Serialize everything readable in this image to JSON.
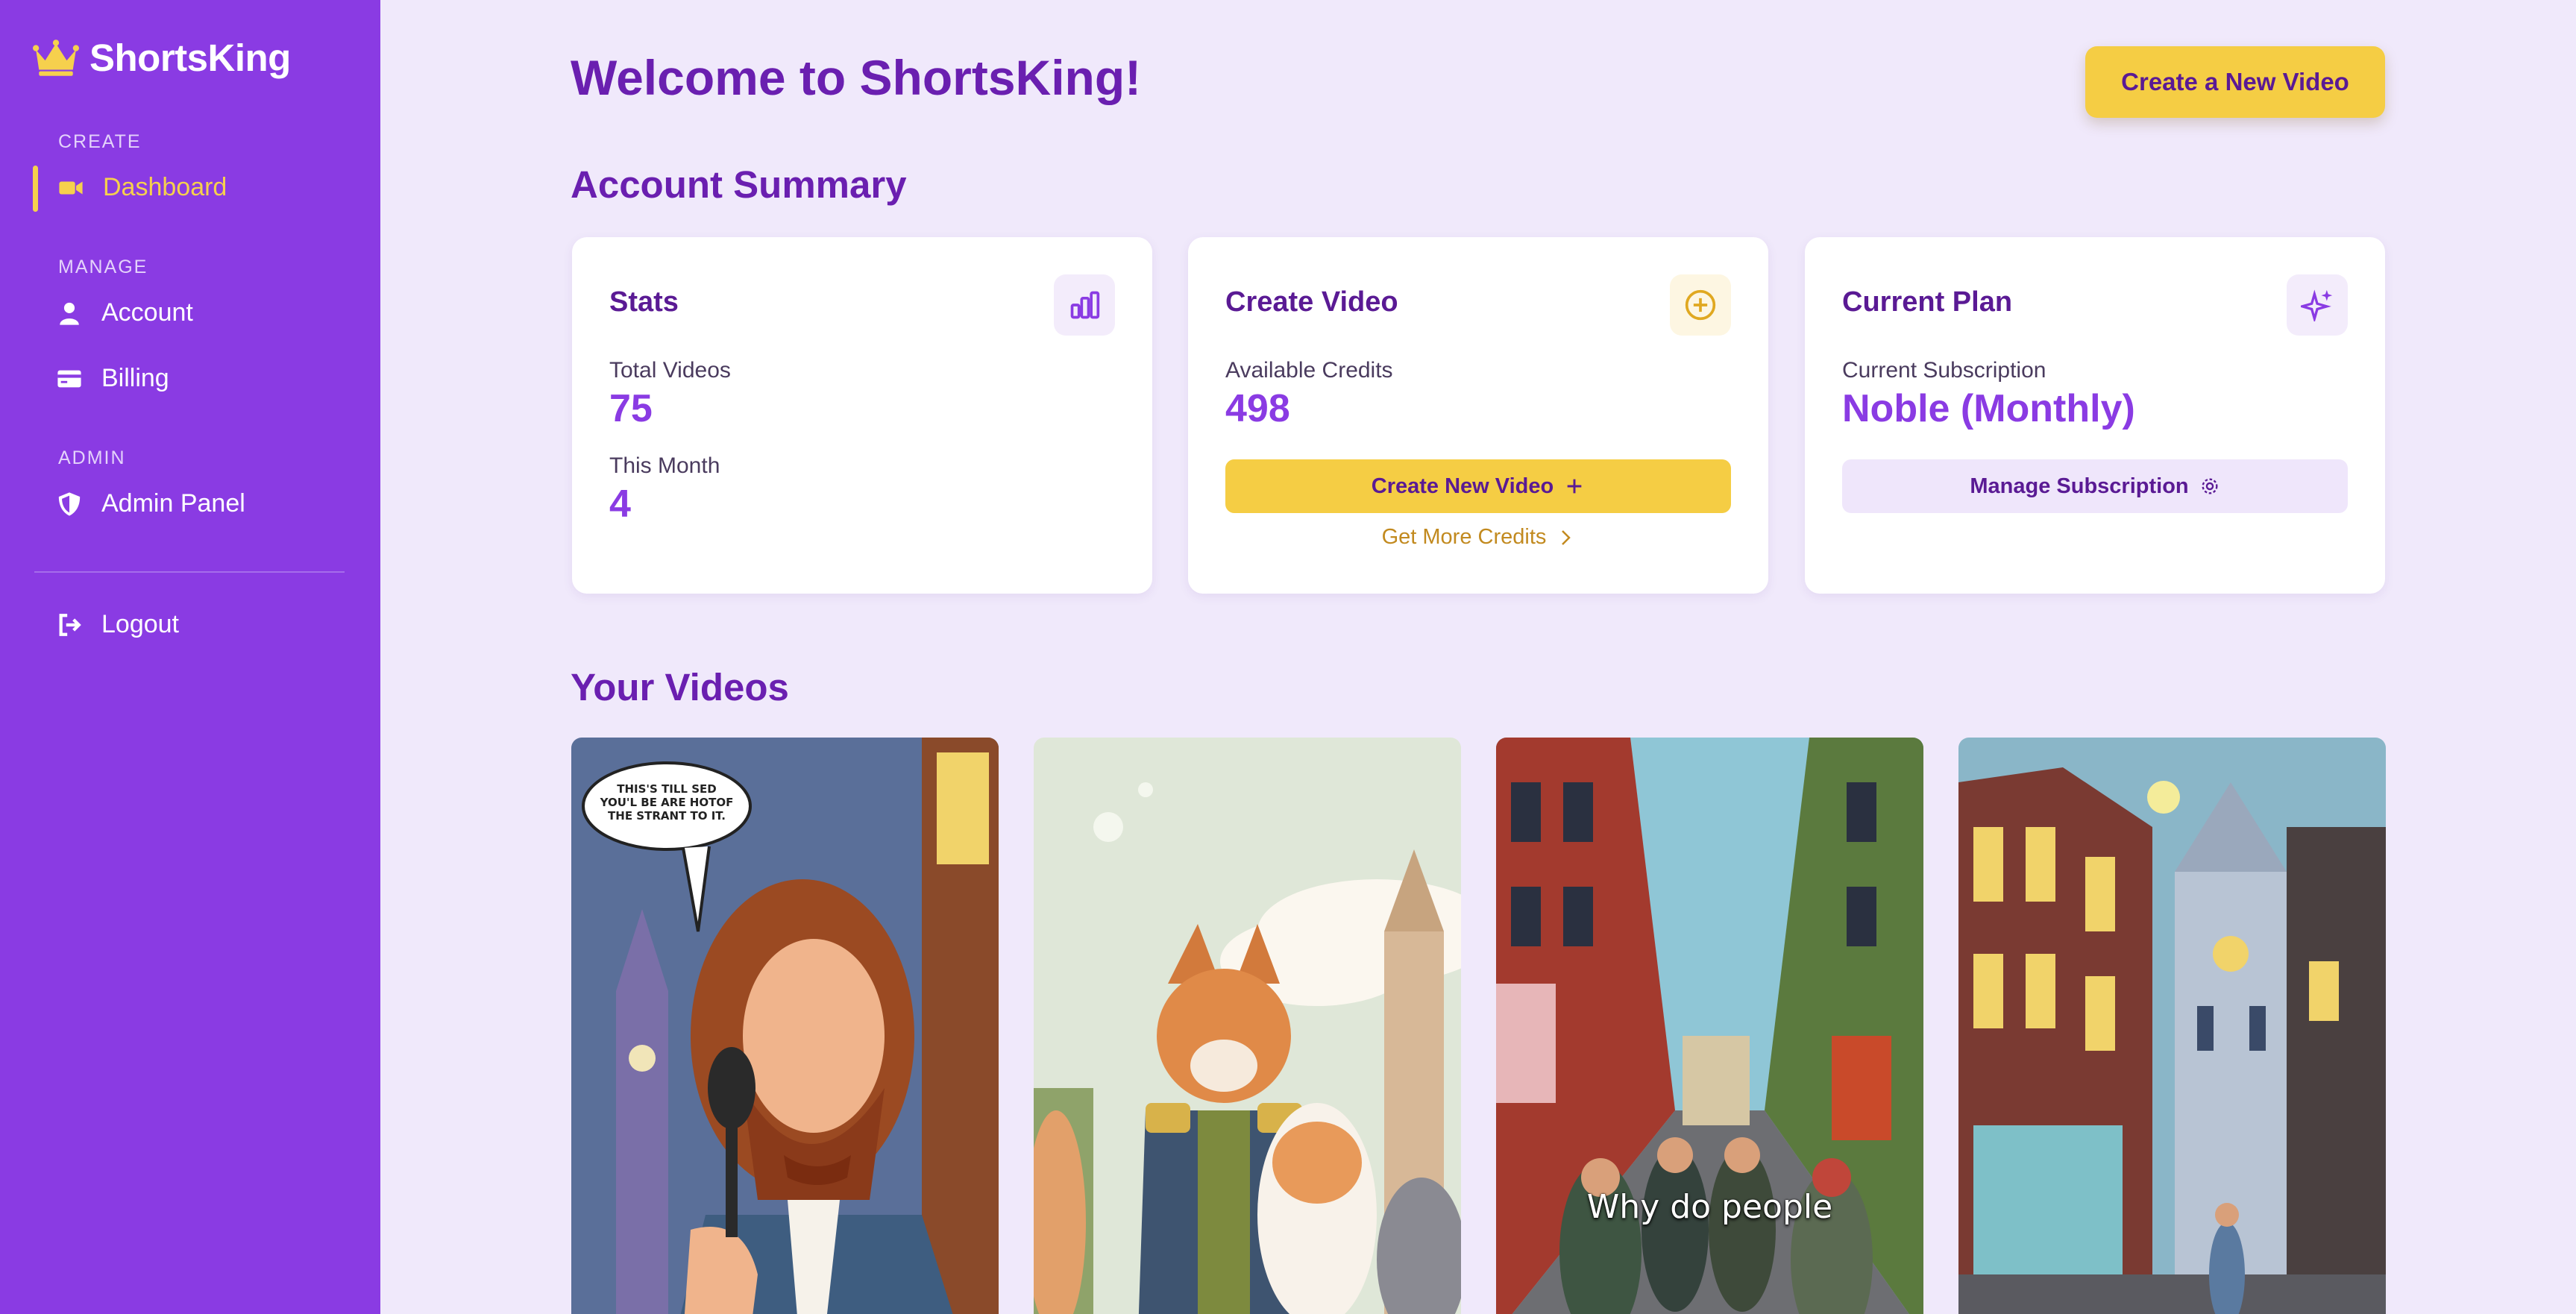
{
  "brand": {
    "name": "ShortsKing",
    "icon": "crown-icon"
  },
  "sidebar": {
    "sections": [
      {
        "label": "CREATE",
        "items": [
          {
            "label": "Dashboard",
            "icon": "video-camera-icon",
            "active": true
          }
        ]
      },
      {
        "label": "MANAGE",
        "items": [
          {
            "label": "Account",
            "icon": "user-icon"
          },
          {
            "label": "Billing",
            "icon": "credit-card-icon"
          }
        ]
      },
      {
        "label": "ADMIN",
        "items": [
          {
            "label": "Admin Panel",
            "icon": "shield-icon"
          }
        ]
      }
    ],
    "logout": {
      "label": "Logout",
      "icon": "logout-icon"
    }
  },
  "header": {
    "title": "Welcome to ShortsKing!",
    "cta_label": "Create a New Video"
  },
  "account_summary": {
    "title": "Account Summary",
    "stats": {
      "title": "Stats",
      "icon": "bar-chart-icon",
      "total_videos_label": "Total Videos",
      "total_videos": "75",
      "this_month_label": "This Month",
      "this_month": "4"
    },
    "create_video": {
      "title": "Create Video",
      "icon": "plus-circle-icon",
      "credits_label": "Available Credits",
      "credits": "498",
      "button_label": "Create New Video",
      "link_label": "Get More Credits"
    },
    "current_plan": {
      "title": "Current Plan",
      "icon": "sparkles-icon",
      "subscription_label": "Current Subscription",
      "subscription": "Noble (Monthly)",
      "button_label": "Manage Subscription"
    }
  },
  "videos": {
    "title": "Your Videos",
    "items": [
      {
        "thumbnail": "comic-gentleman-telephone",
        "caption": "",
        "speech_bubble": "THIS'S TILL SED YOU'L BE ARE HOTOF THE STRANT TO IT."
      },
      {
        "thumbnail": "cat-general-with-cats",
        "caption": ""
      },
      {
        "thumbnail": "comic-city-street-crowd",
        "caption": "Why do people"
      },
      {
        "thumbnail": "comic-night-street-clocktower",
        "caption": ""
      }
    ]
  },
  "colors": {
    "sidebar": "#8a3be3",
    "accent_yellow": "#f5cd44",
    "heading_purple": "#6a1fb0",
    "page_background": "#f0e9fb"
  }
}
